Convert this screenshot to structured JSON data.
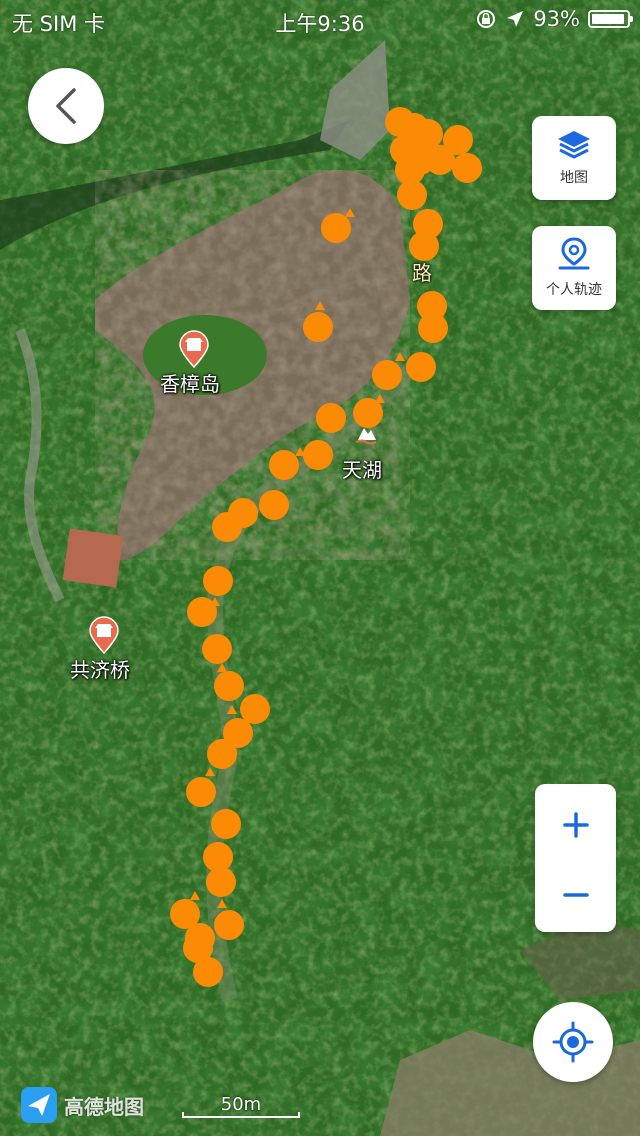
{
  "status_bar": {
    "carrier": "无 SIM 卡",
    "time": "上午9:36",
    "battery": "93%",
    "battery_level": 0.93
  },
  "map": {
    "pois": [
      {
        "id": "xiangzhangdao",
        "label": "香樟岛"
      },
      {
        "id": "tianhu",
        "label": "天湖"
      },
      {
        "id": "gongjiqiao",
        "label": "共济桥"
      }
    ],
    "road_label": "路",
    "track_color": "#fb8a05",
    "scale_label": "50m"
  },
  "controls": {
    "back_icon": "chevron-left-icon",
    "layers_label": "地图",
    "track_label": "个人轨迹",
    "zoom_in": "+",
    "zoom_out": "−",
    "accent_color": "#1b68e0"
  },
  "branding": {
    "logo_text": "高德地图"
  }
}
